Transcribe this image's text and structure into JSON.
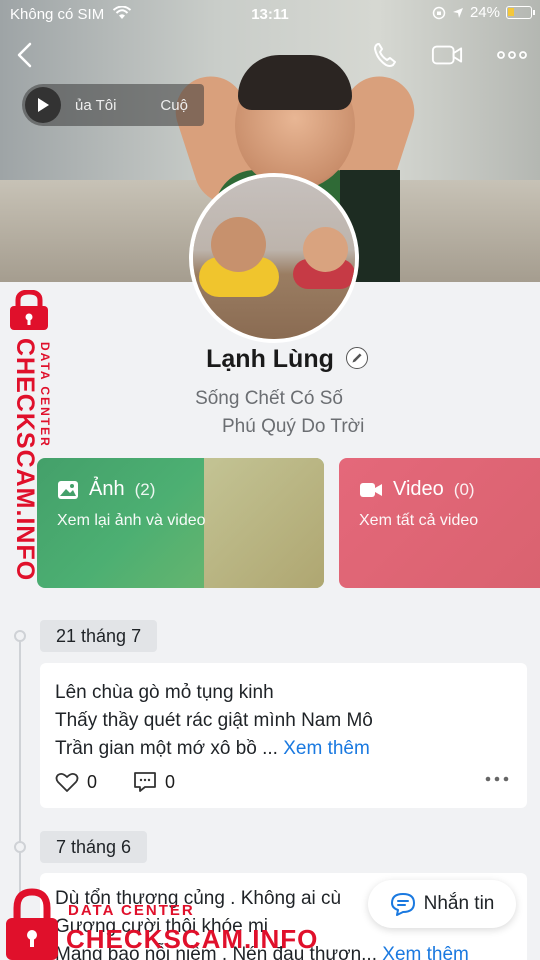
{
  "status_bar": {
    "carrier": "Không có SIM",
    "time": "13:11",
    "battery": "24%"
  },
  "music": {
    "text_left": "ủa Tôi",
    "text_right": "Cuộ"
  },
  "profile": {
    "name": "Lạnh Lùng",
    "bio_line1": "Sống Chết Có Số",
    "bio_line2": "Phú Quý Do Trời"
  },
  "cards": {
    "photos": {
      "title": "Ảnh",
      "count": "(2)",
      "subtitle": "Xem lại ảnh và video"
    },
    "videos": {
      "title": "Video",
      "count": "(0)",
      "subtitle": "Xem tất cả video"
    }
  },
  "posts": [
    {
      "date": "21 tháng 7",
      "line1": "Lên chùa gò mỏ tụng kinh",
      "line2": "Thấy thầy quét rác giật mình Nam Mô",
      "line3": "Trần gian một mớ xô bồ ...",
      "more": "Xem thêm",
      "likes": "0",
      "comments": "0"
    },
    {
      "date": "7 tháng 6",
      "line1": "Dù tổn thương củng . Không ai cù",
      "line2": "Gương cười thôi khóe mi",
      "line3": "Mang bao nỗi niềm . Nén đau thươn...",
      "more": "Xem thêm"
    }
  ],
  "message_button": {
    "label": "Nhắn tin"
  },
  "watermark": {
    "brand": "CHECKSCAM.INFO",
    "tagline": "DATA CENTER"
  },
  "colors": {
    "link": "#1a79e0",
    "photos_card": "#44a06a",
    "videos_card": "#e4687a",
    "watermark": "#e0102b"
  }
}
